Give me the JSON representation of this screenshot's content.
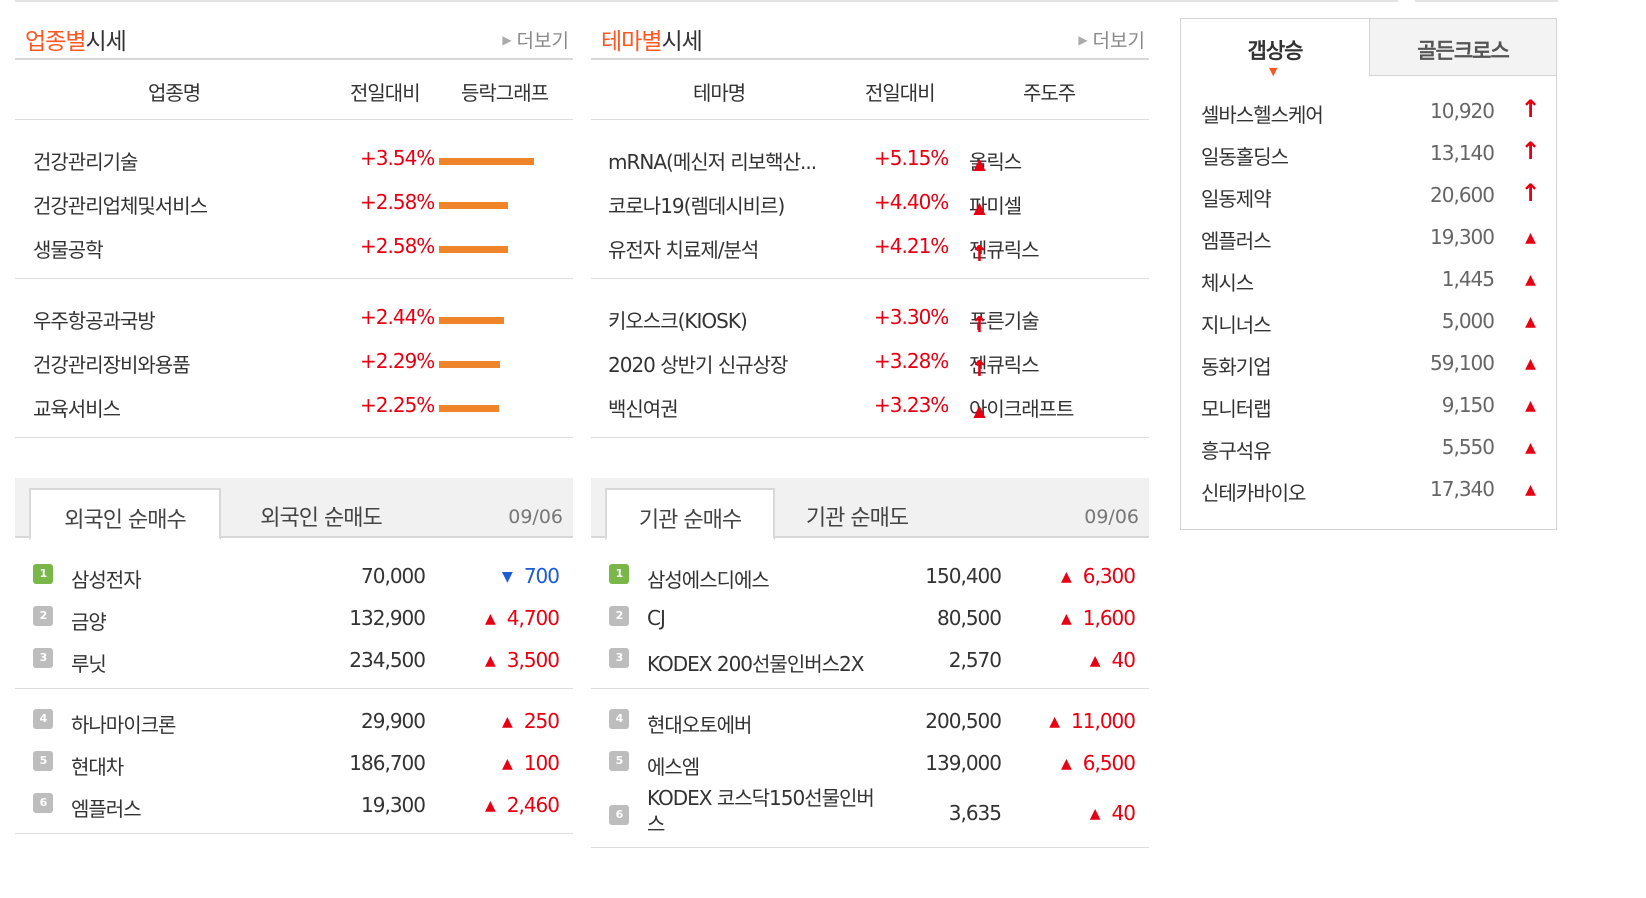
{
  "sector": {
    "title_highlight": "업종별",
    "title_rest": "시세",
    "more": "더보기",
    "headers": [
      "업종명",
      "전일대비",
      "등락그래프"
    ],
    "groups": [
      [
        {
          "name": "건강관리기술",
          "change": "+3.54%",
          "change_value": 3.54
        },
        {
          "name": "건강관리업체및서비스",
          "change": "+2.58%",
          "change_value": 2.58
        },
        {
          "name": "생물공학",
          "change": "+2.58%",
          "change_value": 2.58
        }
      ],
      [
        {
          "name": "우주항공과국방",
          "change": "+2.44%",
          "change_value": 2.44
        },
        {
          "name": "건강관리장비와용품",
          "change": "+2.29%",
          "change_value": 2.29
        },
        {
          "name": "교육서비스",
          "change": "+2.25%",
          "change_value": 2.25
        }
      ]
    ]
  },
  "theme": {
    "title_highlight": "테마별",
    "title_rest": "시세",
    "more": "더보기",
    "headers": [
      "테마명",
      "전일대비",
      "주도주"
    ],
    "groups": [
      [
        {
          "name": "mRNA(메신저 리보핵산...",
          "change": "+5.15%",
          "leader": "올릭스",
          "leader_icon": "triangle-up-icon"
        },
        {
          "name": "코로나19(렘데시비르)",
          "change": "+4.40%",
          "leader": "파미셀",
          "leader_icon": "triangle-up-icon"
        },
        {
          "name": "유전자 치료제/분석",
          "change": "+4.21%",
          "leader": "젠큐릭스",
          "leader_icon": "limit-up-arrow-icon"
        }
      ],
      [
        {
          "name": "키오스크(KIOSK)",
          "change": "+3.30%",
          "leader": "푸른기술",
          "leader_icon": "limit-up-arrow-icon"
        },
        {
          "name": "2020 상반기 신규상장",
          "change": "+3.28%",
          "leader": "젠큐릭스",
          "leader_icon": "limit-up-arrow-icon"
        },
        {
          "name": "백신여권",
          "change": "+3.23%",
          "leader": "아이크래프트",
          "leader_icon": "triangle-up-icon"
        }
      ]
    ]
  },
  "foreign": {
    "tabs": [
      "외국인 순매수",
      "외국인 순매도"
    ],
    "date": "09/06",
    "rows": [
      {
        "rank": "1",
        "name": "삼성전자",
        "price": "70,000",
        "change": "700",
        "dir": "down"
      },
      {
        "rank": "2",
        "name": "금양",
        "price": "132,900",
        "change": "4,700",
        "dir": "up"
      },
      {
        "rank": "3",
        "name": "루닛",
        "price": "234,500",
        "change": "3,500",
        "dir": "up"
      },
      {
        "rank": "4",
        "name": "하나마이크론",
        "price": "29,900",
        "change": "250",
        "dir": "up"
      },
      {
        "rank": "5",
        "name": "현대차",
        "price": "186,700",
        "change": "100",
        "dir": "up"
      },
      {
        "rank": "6",
        "name": "엠플러스",
        "price": "19,300",
        "change": "2,460",
        "dir": "up"
      }
    ]
  },
  "institution": {
    "tabs": [
      "기관 순매수",
      "기관 순매도"
    ],
    "date": "09/06",
    "rows": [
      {
        "rank": "1",
        "name": "삼성에스디에스",
        "price": "150,400",
        "change": "6,300",
        "dir": "up"
      },
      {
        "rank": "2",
        "name": "CJ",
        "price": "80,500",
        "change": "1,600",
        "dir": "up"
      },
      {
        "rank": "3",
        "name": "KODEX 200선물인버스2X",
        "price": "2,570",
        "change": "40",
        "dir": "up"
      },
      {
        "rank": "4",
        "name": "현대오토에버",
        "price": "200,500",
        "change": "11,000",
        "dir": "up"
      },
      {
        "rank": "5",
        "name": "에스엠",
        "price": "139,000",
        "change": "6,500",
        "dir": "up"
      },
      {
        "rank": "6",
        "name_line1": "KODEX 코스닥150선물인버",
        "name_line2": "스",
        "price": "3,635",
        "change": "40",
        "dir": "up"
      }
    ]
  },
  "gap": {
    "tabs": [
      "갭상승",
      "골든크로스"
    ],
    "rows": [
      {
        "name": "셀바스헬스케어",
        "price": "10,920",
        "icon": "limit-up-arrow-icon"
      },
      {
        "name": "일동홀딩스",
        "price": "13,140",
        "icon": "limit-up-arrow-icon"
      },
      {
        "name": "일동제약",
        "price": "20,600",
        "icon": "limit-up-arrow-icon"
      },
      {
        "name": "엠플러스",
        "price": "19,300",
        "icon": "triangle-up-icon"
      },
      {
        "name": "체시스",
        "price": "1,445",
        "icon": "triangle-up-icon"
      },
      {
        "name": "지니너스",
        "price": "5,000",
        "icon": "triangle-up-icon"
      },
      {
        "name": "동화기업",
        "price": "59,100",
        "icon": "triangle-up-icon"
      },
      {
        "name": "모니터랩",
        "price": "9,150",
        "icon": "triangle-up-icon"
      },
      {
        "name": "흥구석유",
        "price": "5,550",
        "icon": "triangle-up-icon"
      },
      {
        "name": "신테카바이오",
        "price": "17,340",
        "icon": "triangle-up-icon"
      }
    ]
  },
  "colors": {
    "accent": "#ff5722",
    "up": "#e60012",
    "down": "#1a5bd6",
    "bar": "#f0842a"
  }
}
